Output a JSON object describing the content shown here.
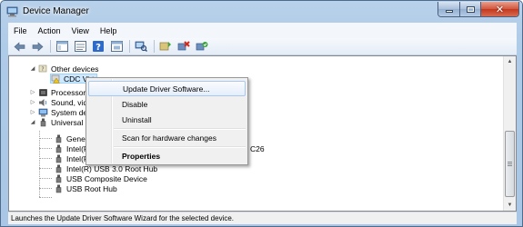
{
  "window": {
    "title": "Device Manager"
  },
  "menubar": {
    "items": [
      "File",
      "Action",
      "View",
      "Help"
    ]
  },
  "toolbar": {
    "buttons": [
      "back-icon",
      "forward-icon",
      "console-tree-icon",
      "properties-icon",
      "help-icon",
      "show-hidden-icon",
      "scan-hardware-icon",
      "update-driver-icon",
      "uninstall-icon",
      "enable-icon"
    ]
  },
  "tree": {
    "other_devices": "Other devices",
    "cdc_virtual": "CDC Virt",
    "processors": "Processors",
    "sound": "Sound, video",
    "system_devices": "System devi",
    "usb_controllers": "Universal Ser",
    "children": [
      "Generic U",
      "Intel(R) 8",
      "Intel(R) U",
      "Intel(R) USB 3.0 Root Hub",
      "USB Composite Device",
      "USB Root Hub"
    ],
    "fragment_c26": "C26"
  },
  "context_menu": {
    "items": [
      {
        "label": "Update Driver Software...",
        "highlighted": true
      },
      {
        "label": "Disable"
      },
      {
        "label": "Uninstall"
      },
      {
        "label": "Scan for hardware changes"
      },
      {
        "label": "Properties",
        "bold": true
      }
    ]
  },
  "statusbar": {
    "text": "Launches the Update Driver Software Wizard for the selected device."
  },
  "colors": {
    "title_gradient_top": "#b9d1ea",
    "close_button": "#c2391f",
    "menu_highlight_border": "#a8c8ef"
  }
}
